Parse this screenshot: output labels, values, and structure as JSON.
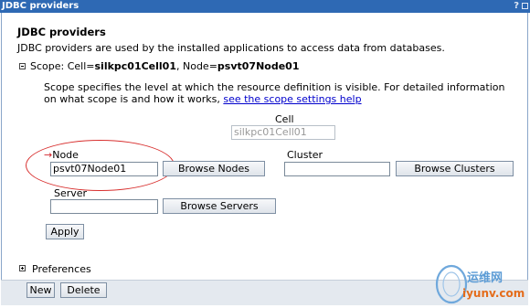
{
  "window": {
    "title": "JDBC providers",
    "help_mark": "?"
  },
  "page": {
    "heading": "JDBC providers",
    "description": "JDBC providers are used by the installed applications to access data from databases.",
    "scope": {
      "prefix": "Scope: Cell=",
      "cell_value": "silkpc01Cell01",
      "node_sep": ", Node=",
      "node_value": "psvt07Node01"
    },
    "help_text": "Scope specifies the level at which the resource definition is visible. For detailed information on what scope is and how it works, ",
    "help_link": "see the scope settings help"
  },
  "form": {
    "cell_label": "Cell",
    "cell_value": "silkpc01Cell01",
    "node_required_mark": "→",
    "node_label": "Node",
    "node_value": "psvt07Node01",
    "browse_nodes": "Browse Nodes",
    "cluster_label": "Cluster",
    "cluster_value": "",
    "browse_clusters": "Browse Clusters",
    "server_label": "Server",
    "server_value": "",
    "browse_servers": "Browse Servers",
    "apply": "Apply"
  },
  "preferences": {
    "label": "Preferences"
  },
  "toolbar": {
    "new_label": "New",
    "delete_label": "Delete"
  },
  "watermark": {
    "chinese": "运维网",
    "url": "iyunv.com"
  },
  "colors": {
    "titlebar": "#2e69b4",
    "link": "#0000cc",
    "annotation_circle": "#d8302f"
  }
}
